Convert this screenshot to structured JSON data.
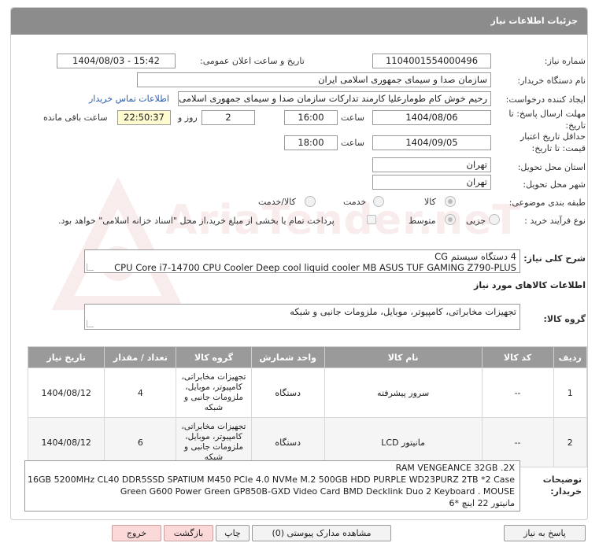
{
  "header": {
    "title": "جزئیات اطلاعات نیاز"
  },
  "fields": {
    "need_number_label": "شماره نیاز:",
    "need_number": "1104001554000496",
    "announce_label": "تاریخ و ساعت اعلان عمومی:",
    "announce_value": "1404/08/03 - 15:42",
    "buyer_org_label": "نام دستگاه خریدار:",
    "buyer_org": "سازمان صدا و سیمای جمهوری اسلامی ایران",
    "creator_label": "ایجاد کننده درخواست:",
    "creator": "رحیم خوش کام طومارعلیا کارمند تدارکات سازمان صدا و سیمای جمهوری اسلامی",
    "contact_link": "اطلاعات تماس خریدار",
    "deadline_label_1": "مهلت ارسال پاسخ: تا",
    "deadline_label_2": "تاریخ:",
    "deadline_date": "1404/08/06",
    "time_label": "ساعت",
    "deadline_time": "16:00",
    "days_value": "2",
    "days_label": "روز و",
    "remaining_time": "22:50:37",
    "remaining_label": "ساعت باقی مانده",
    "validity_label_1": "حداقل تاریخ اعتبار",
    "validity_label_2": "قیمت: تا تاریخ:",
    "validity_date": "1404/09/05",
    "validity_time": "18:00",
    "province_label": "استان محل تحویل:",
    "province": "تهران",
    "city_label": "شهر محل تحویل:",
    "city": "تهران",
    "category_label": "طبقه بندی موضوعی:",
    "cat_goods": "کالا",
    "cat_service": "خدمت",
    "cat_goods_service": "کالا/خدمت",
    "process_label": "نوع فرآیند خرید :",
    "proc_partial": "جزیی",
    "proc_medium": "متوسط",
    "payment_note": "پرداخت تمام یا بخشی از مبلغ خرید،از محل \"اسناد خزانه اسلامی\" خواهد بود."
  },
  "description": {
    "label": "شرح کلی نیاز:",
    "line1": "4 دستگاه سیستم CG",
    "line2": "CPU Core i7-14700 CPU Cooler Deep cool liquid cooler MB ASUS TUF GAMING Z790-PLUS"
  },
  "goods": {
    "section_title": "اطلاعات کالاهای مورد نیاز",
    "group_label": "گروه کالا:",
    "group_value": "تجهیزات مخابراتی، کامپیوتر، موبایل، ملزومات جانبی و شبکه"
  },
  "table": {
    "headers": [
      "ردیف",
      "کد کالا",
      "نام کالا",
      "واحد شمارش",
      "گروه کالا",
      "تعداد / مقدار",
      "تاریخ نیاز"
    ],
    "rows": [
      {
        "row": "1",
        "code": "--",
        "name": "سرور پیشرفته",
        "unit": "دستگاه",
        "group": "تجهیزات مخابراتی، کامپیوتر، موبایل، ملزومات جانبی و شبکه",
        "qty": "4",
        "date": "1404/08/12"
      },
      {
        "row": "2",
        "code": "--",
        "name": "مانیتور LCD",
        "unit": "دستگاه",
        "group": "تجهیزات مخابراتی، کامپیوتر، موبایل، ملزومات جانبی و شبکه",
        "qty": "6",
        "date": "1404/08/12"
      }
    ]
  },
  "notes": {
    "label_1": "توضیحات",
    "label_2": "خریدار:",
    "line1": "RAM VENGEANCE 32GB .2X",
    "line2": "16GB 5200MHz CL40 DDR5SSD SPATIUM M450 PCIe 4.0 NVMe M.2 500GB HDD PURPLE WD23PURZ 2TB *2 Case",
    "line3": "Green G600 Power Green GP850B-GXD Video Card BMD Decklink Duo 2 Keyboard . MOUSE",
    "line4": "مانیتور 22 اینچ *6"
  },
  "buttons": {
    "reply": "پاسخ به نیاز",
    "attachments": "مشاهده مدارک پیوستی (0)",
    "print": "چاپ",
    "back": "بازگشت",
    "exit": "خروج"
  }
}
